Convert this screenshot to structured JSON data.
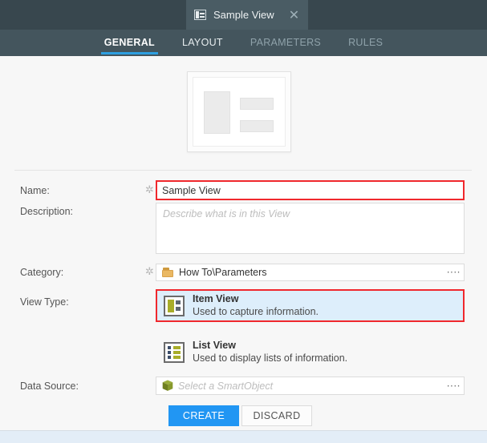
{
  "titlebar": {
    "tab": {
      "icon": "item-view-icon",
      "title": "Sample View",
      "close_label": "✕"
    }
  },
  "tabstrip": {
    "tabs": [
      {
        "label": "GENERAL",
        "state": "active"
      },
      {
        "label": "LAYOUT",
        "state": "lit"
      },
      {
        "label": "PARAMETERS",
        "state": "dim"
      },
      {
        "label": "RULES",
        "state": "dim"
      }
    ]
  },
  "thumbnail": {
    "icon": "item-view-preview"
  },
  "form": {
    "name": {
      "label": "Name:",
      "required_marker": "✲",
      "value": "Sample View"
    },
    "description": {
      "label": "Description:",
      "value": "",
      "placeholder": "Describe what is in this View"
    },
    "category": {
      "label": "Category:",
      "required_marker": "✲",
      "icon": "folder-icon",
      "value": "How To\\Parameters",
      "browse_label": "····"
    },
    "view_type": {
      "label": "View Type:",
      "options": [
        {
          "icon": "item-view-icon",
          "title": "Item View",
          "description": "Used to capture information.",
          "selected": true
        },
        {
          "icon": "list-view-icon",
          "title": "List View",
          "description": "Used to display lists of information.",
          "selected": false
        }
      ]
    },
    "data_source": {
      "label": "Data Source:",
      "icon": "smartobject-cube-icon",
      "value": "",
      "placeholder": "Select a SmartObject",
      "browse_label": "····"
    }
  },
  "actions": {
    "create_label": "CREATE",
    "discard_label": "DISCARD"
  },
  "colors": {
    "titlebar": "#38474e",
    "tab_active": "#4a5c64",
    "tabstrip": "#44555d",
    "accent_underline": "#2e9fe0",
    "primary_button": "#2196f3",
    "highlight_border": "#f0282d",
    "selection_fill": "#ddeefb",
    "folder": "#eab863",
    "item_block": "#a8ad29",
    "footer": "#e3edf7"
  }
}
